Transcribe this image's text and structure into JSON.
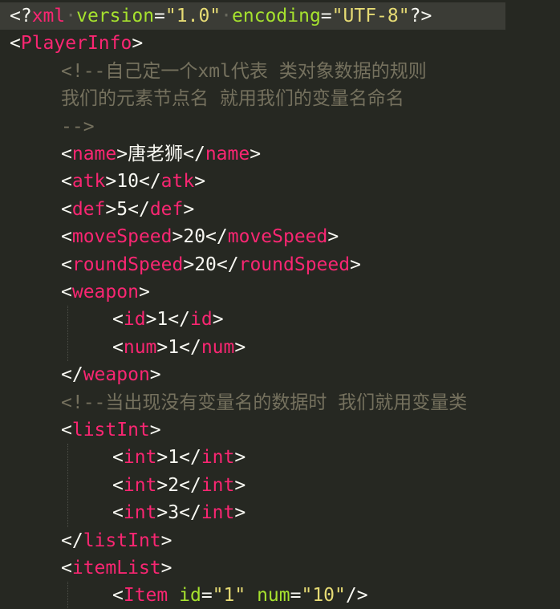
{
  "editor": {
    "theme": {
      "background": "#262822",
      "current_line": "#3b3c36",
      "punctuation": "#f8f8f2",
      "tag": "#f92672",
      "attribute": "#a6e22e",
      "string": "#e6db74",
      "text": "#f8f8f2",
      "comment": "#75715e"
    },
    "lines": [
      {
        "indent": 0,
        "highlight": true,
        "tokens": [
          {
            "t": "p",
            "v": "<?"
          },
          {
            "t": "t",
            "v": "xml"
          },
          {
            "t": "d",
            "v": "·"
          },
          {
            "t": "a",
            "v": "version"
          },
          {
            "t": "p",
            "v": "="
          },
          {
            "t": "s",
            "v": "\"1.0\""
          },
          {
            "t": "d",
            "v": "·"
          },
          {
            "t": "a",
            "v": "encoding"
          },
          {
            "t": "p",
            "v": "="
          },
          {
            "t": "s",
            "v": "\"UTF-8\""
          },
          {
            "t": "p",
            "v": "?>"
          }
        ]
      },
      {
        "indent": 0,
        "tokens": [
          {
            "t": "p",
            "v": "<"
          },
          {
            "t": "t",
            "v": "PlayerInfo"
          },
          {
            "t": "p",
            "v": ">"
          }
        ]
      },
      {
        "indent": 1,
        "tokens": [
          {
            "t": "c",
            "v": "<!--自己定一个xml代表 类对象数据的规则"
          }
        ]
      },
      {
        "indent": 1,
        "tokens": [
          {
            "t": "c",
            "v": "我们的元素节点名 就用我们的变量名命名"
          }
        ]
      },
      {
        "indent": 1,
        "tokens": [
          {
            "t": "c",
            "v": "-->"
          }
        ]
      },
      {
        "indent": 1,
        "tokens": [
          {
            "t": "p",
            "v": "<"
          },
          {
            "t": "t",
            "v": "name"
          },
          {
            "t": "p",
            "v": ">"
          },
          {
            "t": "x",
            "v": "唐老狮"
          },
          {
            "t": "p",
            "v": "</"
          },
          {
            "t": "t",
            "v": "name"
          },
          {
            "t": "p",
            "v": ">"
          }
        ]
      },
      {
        "indent": 1,
        "tokens": [
          {
            "t": "p",
            "v": "<"
          },
          {
            "t": "t",
            "v": "atk"
          },
          {
            "t": "p",
            "v": ">"
          },
          {
            "t": "x",
            "v": "10"
          },
          {
            "t": "p",
            "v": "</"
          },
          {
            "t": "t",
            "v": "atk"
          },
          {
            "t": "p",
            "v": ">"
          }
        ]
      },
      {
        "indent": 1,
        "tokens": [
          {
            "t": "p",
            "v": "<"
          },
          {
            "t": "t",
            "v": "def"
          },
          {
            "t": "p",
            "v": ">"
          },
          {
            "t": "x",
            "v": "5"
          },
          {
            "t": "p",
            "v": "</"
          },
          {
            "t": "t",
            "v": "def"
          },
          {
            "t": "p",
            "v": ">"
          }
        ]
      },
      {
        "indent": 1,
        "tokens": [
          {
            "t": "p",
            "v": "<"
          },
          {
            "t": "t",
            "v": "moveSpeed"
          },
          {
            "t": "p",
            "v": ">"
          },
          {
            "t": "x",
            "v": "20"
          },
          {
            "t": "p",
            "v": "</"
          },
          {
            "t": "t",
            "v": "moveSpeed"
          },
          {
            "t": "p",
            "v": ">"
          }
        ]
      },
      {
        "indent": 1,
        "tokens": [
          {
            "t": "p",
            "v": "<"
          },
          {
            "t": "t",
            "v": "roundSpeed"
          },
          {
            "t": "p",
            "v": ">"
          },
          {
            "t": "x",
            "v": "20"
          },
          {
            "t": "p",
            "v": "</"
          },
          {
            "t": "t",
            "v": "roundSpeed"
          },
          {
            "t": "p",
            "v": ">"
          }
        ]
      },
      {
        "indent": 1,
        "tokens": [
          {
            "t": "p",
            "v": "<"
          },
          {
            "t": "t",
            "v": "weapon"
          },
          {
            "t": "p",
            "v": ">"
          }
        ]
      },
      {
        "indent": 2,
        "tokens": [
          {
            "t": "p",
            "v": "<"
          },
          {
            "t": "t",
            "v": "id"
          },
          {
            "t": "p",
            "v": ">"
          },
          {
            "t": "x",
            "v": "1"
          },
          {
            "t": "p",
            "v": "</"
          },
          {
            "t": "t",
            "v": "id"
          },
          {
            "t": "p",
            "v": ">"
          }
        ]
      },
      {
        "indent": 2,
        "tokens": [
          {
            "t": "p",
            "v": "<"
          },
          {
            "t": "t",
            "v": "num"
          },
          {
            "t": "p",
            "v": ">"
          },
          {
            "t": "x",
            "v": "1"
          },
          {
            "t": "p",
            "v": "</"
          },
          {
            "t": "t",
            "v": "num"
          },
          {
            "t": "p",
            "v": ">"
          }
        ]
      },
      {
        "indent": 1,
        "tokens": [
          {
            "t": "p",
            "v": "</"
          },
          {
            "t": "t",
            "v": "weapon"
          },
          {
            "t": "p",
            "v": ">"
          }
        ]
      },
      {
        "indent": 1,
        "tokens": [
          {
            "t": "c",
            "v": "<!--当出现没有变量名的数据时 我们就用变量类"
          }
        ]
      },
      {
        "indent": 1,
        "tokens": [
          {
            "t": "p",
            "v": "<"
          },
          {
            "t": "t",
            "v": "listInt"
          },
          {
            "t": "p",
            "v": ">"
          }
        ]
      },
      {
        "indent": 2,
        "tokens": [
          {
            "t": "p",
            "v": "<"
          },
          {
            "t": "t",
            "v": "int"
          },
          {
            "t": "p",
            "v": ">"
          },
          {
            "t": "x",
            "v": "1"
          },
          {
            "t": "p",
            "v": "</"
          },
          {
            "t": "t",
            "v": "int"
          },
          {
            "t": "p",
            "v": ">"
          }
        ]
      },
      {
        "indent": 2,
        "tokens": [
          {
            "t": "p",
            "v": "<"
          },
          {
            "t": "t",
            "v": "int"
          },
          {
            "t": "p",
            "v": ">"
          },
          {
            "t": "x",
            "v": "2"
          },
          {
            "t": "p",
            "v": "</"
          },
          {
            "t": "t",
            "v": "int"
          },
          {
            "t": "p",
            "v": ">"
          }
        ]
      },
      {
        "indent": 2,
        "tokens": [
          {
            "t": "p",
            "v": "<"
          },
          {
            "t": "t",
            "v": "int"
          },
          {
            "t": "p",
            "v": ">"
          },
          {
            "t": "x",
            "v": "3"
          },
          {
            "t": "p",
            "v": "</"
          },
          {
            "t": "t",
            "v": "int"
          },
          {
            "t": "p",
            "v": ">"
          }
        ]
      },
      {
        "indent": 1,
        "tokens": [
          {
            "t": "p",
            "v": "</"
          },
          {
            "t": "t",
            "v": "listInt"
          },
          {
            "t": "p",
            "v": ">"
          }
        ]
      },
      {
        "indent": 1,
        "tokens": [
          {
            "t": "p",
            "v": "<"
          },
          {
            "t": "t",
            "v": "itemList"
          },
          {
            "t": "p",
            "v": ">"
          }
        ]
      },
      {
        "indent": 2,
        "tokens": [
          {
            "t": "p",
            "v": "<"
          },
          {
            "t": "t",
            "v": "Item"
          },
          {
            "t": "p",
            "v": " "
          },
          {
            "t": "a",
            "v": "id"
          },
          {
            "t": "p",
            "v": "="
          },
          {
            "t": "s",
            "v": "\"1\""
          },
          {
            "t": "p",
            "v": " "
          },
          {
            "t": "a",
            "v": "num"
          },
          {
            "t": "p",
            "v": "="
          },
          {
            "t": "s",
            "v": "\"10\""
          },
          {
            "t": "p",
            "v": "/>"
          }
        ]
      }
    ]
  }
}
